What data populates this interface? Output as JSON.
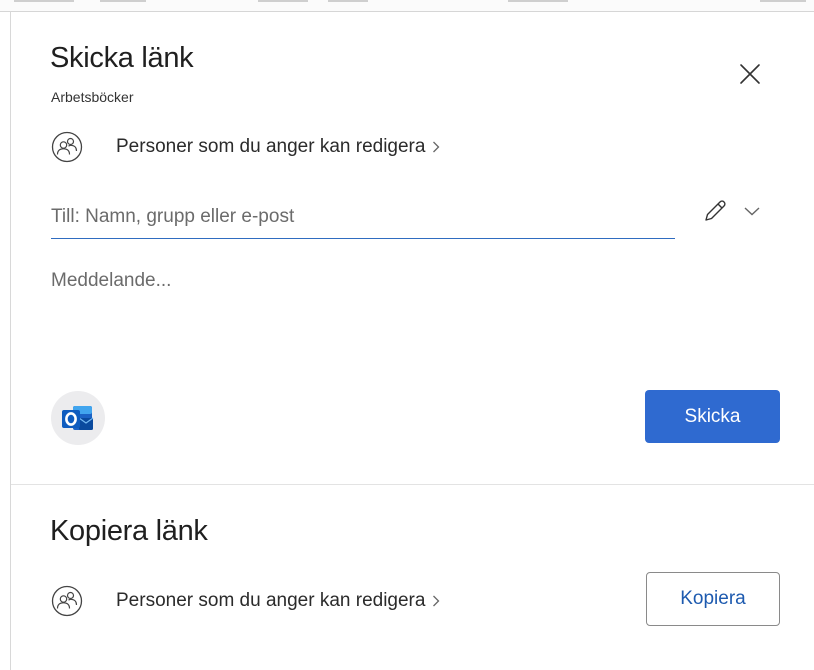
{
  "send_link": {
    "title": "Skicka länk",
    "subtitle": "Arbetsböcker",
    "permission_text": "Personer som du anger kan redigera",
    "to_placeholder": "Till: Namn, grupp eller e-post",
    "message_placeholder": "Meddelande...",
    "send_label": "Skicka"
  },
  "copy_link": {
    "title": "Kopiera länk",
    "permission_text": "Personer som du anger kan redigera",
    "copy_label": "Kopiera"
  },
  "icons": {
    "close": "close-icon",
    "people": "people-icon",
    "chevron_right": "chevron-right-icon",
    "pencil": "pencil-icon",
    "chevron_down": "chevron-down-icon",
    "outlook": "outlook-icon"
  },
  "colors": {
    "accent": "#2f6ad0",
    "copy_text": "#1d5aaf",
    "input_underline": "#2f6cc0"
  }
}
